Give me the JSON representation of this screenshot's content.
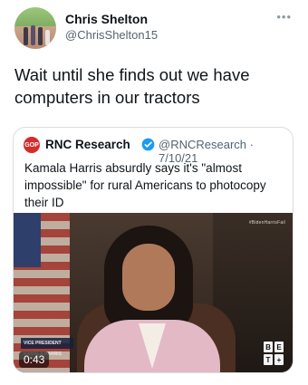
{
  "tweet": {
    "author": {
      "name": "Chris Shelton",
      "handle": "@ChrisShelton15"
    },
    "more_icon": "more-options-icon",
    "text": "Wait until she finds out we have computers in our tractors"
  },
  "quote": {
    "avatar_text": "GOP",
    "author_name": "RNC Research",
    "verified_icon": "verified-badge-icon",
    "handle_date": "@RNCResearch · 7/10/21",
    "text": "Kamala Harris absurdly says it's \"almost impossible\" for rural Americans to photocopy their ID",
    "media": {
      "watermark": "#BidenHarrisFail",
      "lower_third": "VICE PRESIDENT KAMALA HARRIS",
      "duration": "0:43",
      "network_logo": [
        "B",
        "E",
        "T",
        "+"
      ]
    }
  },
  "colors": {
    "text": "#0f1419",
    "secondary_text": "#536471",
    "verified": "#1d9bf0",
    "border": "#d9dde1"
  }
}
